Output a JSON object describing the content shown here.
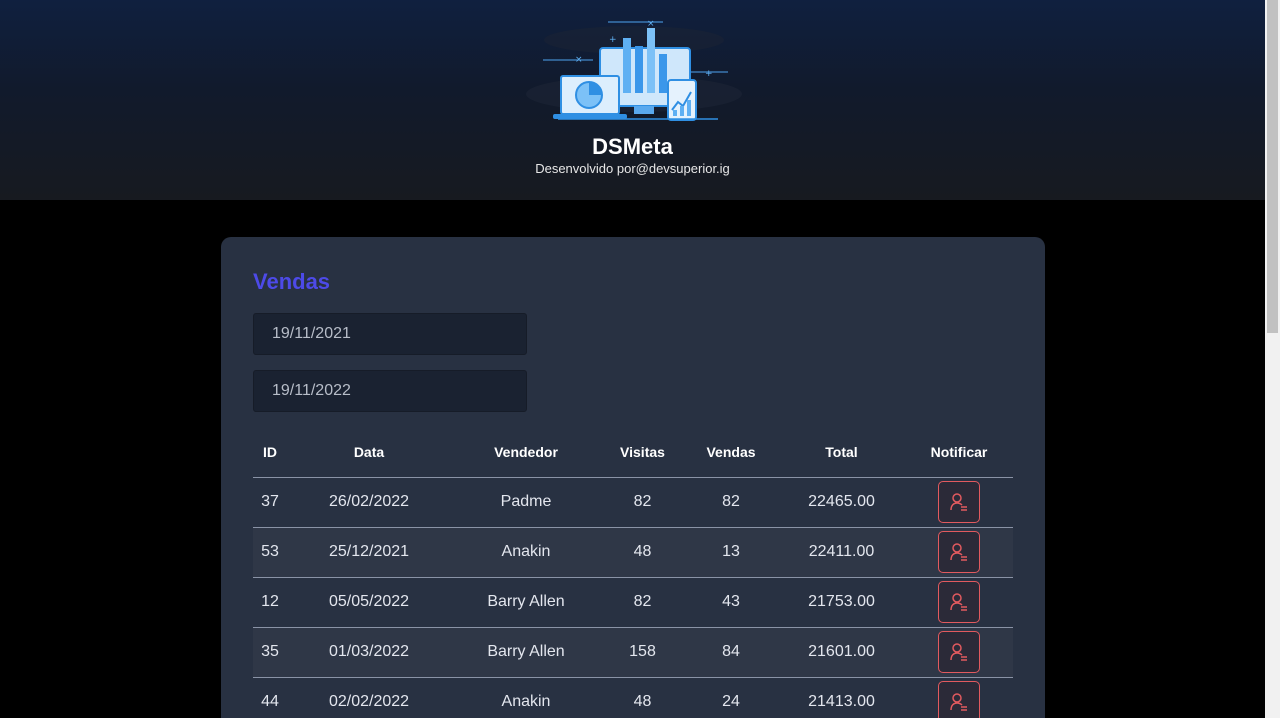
{
  "header": {
    "title": "DSMeta",
    "subtitle": "Desenvolvido por@devsuperior.ig",
    "logo_icon": "dashboard-devices-illustration"
  },
  "sales": {
    "title": "Vendas",
    "min_date": "19/11/2021",
    "max_date": "19/11/2022",
    "columns": [
      "ID",
      "Data",
      "Vendedor",
      "Visitas",
      "Vendas",
      "Total",
      "Notificar"
    ],
    "rows": [
      {
        "id": "37",
        "date": "26/02/2022",
        "seller": "Padme",
        "visited": "82",
        "deals": "82",
        "total": "22465.00"
      },
      {
        "id": "53",
        "date": "25/12/2021",
        "seller": "Anakin",
        "visited": "48",
        "deals": "13",
        "total": "22411.00"
      },
      {
        "id": "12",
        "date": "05/05/2022",
        "seller": "Barry Allen",
        "visited": "82",
        "deals": "43",
        "total": "21753.00"
      },
      {
        "id": "35",
        "date": "01/03/2022",
        "seller": "Barry Allen",
        "visited": "158",
        "deals": "84",
        "total": "21601.00"
      },
      {
        "id": "44",
        "date": "02/02/2022",
        "seller": "Anakin",
        "visited": "48",
        "deals": "24",
        "total": "21413.00"
      }
    ],
    "notify_icon": "notify-user-icon"
  },
  "colors": {
    "accent": "#4d4ae8",
    "notify": "#e25a5f",
    "card": "#283142"
  }
}
